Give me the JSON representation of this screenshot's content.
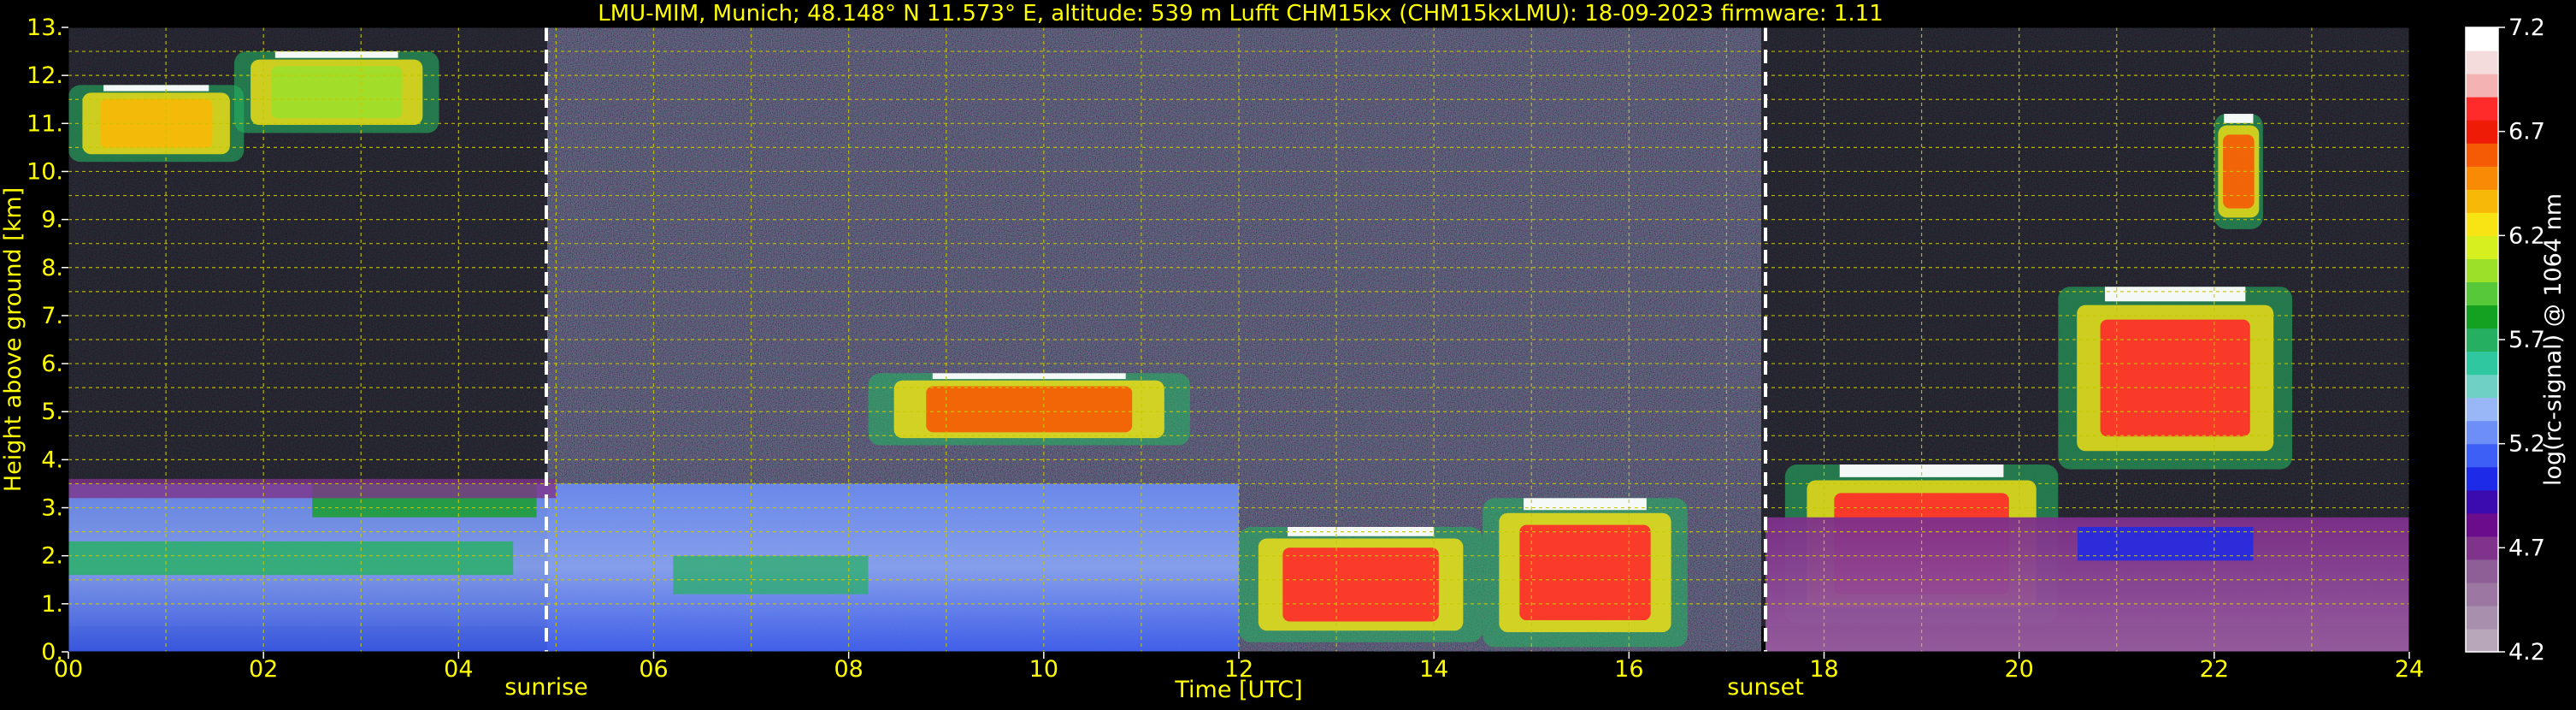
{
  "chart_data": {
    "type": "heatmap",
    "title": "LMU-MIM, Munich; 48.148° N 11.573° E, altitude: 539 m    Lufft CHM15kx (CHM15kxLMU): 18-09-2023    firmware: 1.11",
    "xlabel": "Time [UTC]",
    "ylabel": "Height above ground [km]",
    "xlim": [
      0,
      24
    ],
    "ylim": [
      0,
      13
    ],
    "x_ticks": [
      "00",
      "02",
      "04",
      "06",
      "08",
      "10",
      "12",
      "14",
      "16",
      "18",
      "20",
      "22",
      "24"
    ],
    "y_ticks": [
      "0.",
      "1.",
      "2.",
      "3.",
      "4.",
      "5.",
      "6.",
      "7.",
      "8.",
      "9.",
      "10.",
      "11.",
      "12.",
      "13."
    ],
    "grid": true,
    "markers": [
      {
        "label": "sunrise",
        "x": 4.9
      },
      {
        "label": "sunset",
        "x": 17.4
      }
    ],
    "colorbar": {
      "label": "log(rc-signal) @ 1064 nm",
      "range": [
        4.2,
        7.2
      ],
      "ticks": [
        "7.2",
        "6.7",
        "6.2",
        "5.7",
        "5.2",
        "4.7",
        "4.2"
      ],
      "colors": [
        "#b8a7bb",
        "#a88fae",
        "#9b77a2",
        "#8e5e97",
        "#80338a",
        "#6a0c8c",
        "#3b0bb0",
        "#1d2ae8",
        "#3d5ff5",
        "#6c8ef6",
        "#99b7f7",
        "#6fd1c6",
        "#2fc7a0",
        "#24b060",
        "#14a020",
        "#56c83a",
        "#9de02a",
        "#d6f01f",
        "#f8e414",
        "#f8b808",
        "#f88a06",
        "#f55a05",
        "#ee1c06",
        "#ff2a2a",
        "#f4b2b2",
        "#f4dcdc",
        "#ffffff"
      ]
    },
    "features": [
      {
        "name": "cirrus",
        "t0": 0.0,
        "t1": 1.8,
        "h0": 10.2,
        "h1": 11.8,
        "level": 6.4
      },
      {
        "name": "cirrus",
        "t0": 1.7,
        "t1": 3.8,
        "h0": 10.8,
        "h1": 12.5,
        "level": 6.0
      },
      {
        "name": "cirrus",
        "t0": 22.0,
        "t1": 22.5,
        "h0": 8.8,
        "h1": 11.2,
        "level": 6.6
      },
      {
        "name": "aerosol-layer",
        "t0": 8.2,
        "t1": 11.5,
        "h0": 4.3,
        "h1": 5.8,
        "level": 6.6
      },
      {
        "name": "cloud-base",
        "t0": 12.0,
        "t1": 14.5,
        "h0": 0.2,
        "h1": 2.6,
        "level": 6.9
      },
      {
        "name": "cloud-base",
        "t0": 14.5,
        "t1": 16.6,
        "h0": 0.1,
        "h1": 3.2,
        "level": 6.8
      },
      {
        "name": "cloud-base",
        "t0": 17.6,
        "t1": 20.4,
        "h0": 0.6,
        "h1": 3.9,
        "level": 6.8
      },
      {
        "name": "cloud",
        "t0": 20.4,
        "t1": 22.8,
        "h0": 3.8,
        "h1": 7.6,
        "level": 6.8
      },
      {
        "name": "boundary-layer",
        "t0": 0.0,
        "t1": 12.0,
        "h0": 0.0,
        "h1": 3.5,
        "level": 5.3
      },
      {
        "name": "residual-layer",
        "t0": 17.4,
        "t1": 24.0,
        "h0": 0.0,
        "h1": 2.8,
        "level": 4.8
      }
    ]
  }
}
